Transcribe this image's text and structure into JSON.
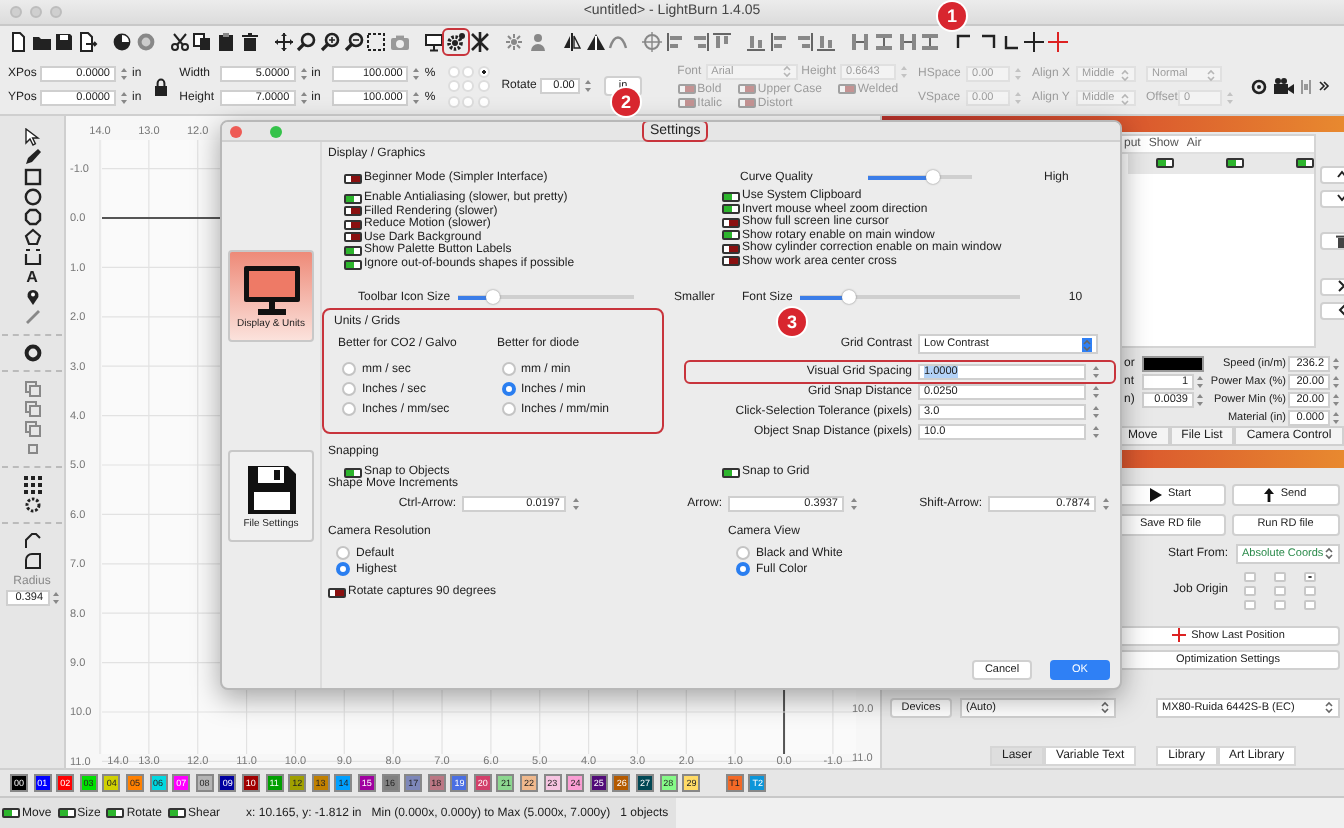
{
  "window": {
    "title": "<untitled> - LightBurn 1.4.05"
  },
  "annotations": [
    {
      "label": "1"
    },
    {
      "label": "2"
    },
    {
      "label": "3"
    }
  ],
  "toolbar": {
    "settings_button": {
      "annotated": true
    }
  },
  "property_bar": {
    "xpos": {
      "label": "XPos",
      "value": "0.0000",
      "unit": "in"
    },
    "ypos": {
      "label": "YPos",
      "value": "0.0000",
      "unit": "in"
    },
    "width": {
      "label": "Width",
      "value": "5.0000",
      "unit": "in"
    },
    "height": {
      "label": "Height",
      "value": "7.0000",
      "unit": "in"
    },
    "scale_x": {
      "value": "100.000",
      "unit": "%"
    },
    "scale_y": {
      "value": "100.000",
      "unit": "%"
    },
    "origin": [
      {
        "selected": false
      },
      {
        "selected": false
      },
      {
        "selected": true
      },
      {
        "selected": false
      },
      {
        "selected": false
      },
      {
        "selected": false
      },
      {
        "selected": false
      },
      {
        "selected": false
      },
      {
        "selected": false
      }
    ],
    "rotate": {
      "label": "Rotate",
      "value": "0.00"
    },
    "unit_button": "in",
    "text_tools_disabled": true,
    "font": {
      "label": "Font",
      "value": "Arial"
    },
    "text_height": {
      "label": "Height",
      "value": "0.6643"
    },
    "text_options": [
      {
        "label": "Bold",
        "on": false
      },
      {
        "label": "Italic",
        "on": false
      },
      {
        "label": "Upper Case",
        "on": false
      },
      {
        "label": "Distort",
        "on": false
      },
      {
        "label": "Welded",
        "on": false
      }
    ],
    "hspace": {
      "label": "HSpace",
      "value": "0.00"
    },
    "vspace": {
      "label": "VSpace",
      "value": "0.00"
    },
    "align_x": {
      "label": "Align X",
      "value": "Middle"
    },
    "align_y": {
      "label": "Align Y",
      "value": "Middle"
    },
    "mode": {
      "value": "Normal"
    },
    "offset": {
      "label": "Offset",
      "value": "0"
    }
  },
  "tools": {
    "text_glyph": "A",
    "radius": {
      "label": "Radius",
      "value": "0.394"
    }
  },
  "canvas": {
    "top_ruler": [
      "14.0",
      "13.0",
      "12.0"
    ],
    "left_ruler": [
      "-1.0",
      "0.0",
      "1.0",
      "2.0",
      "3.0",
      "4.0",
      "5.0",
      "6.0",
      "7.0",
      "8.0",
      "9.0",
      "10.0",
      "11.0"
    ],
    "bottom_ruler": [
      "14.0",
      "13.0",
      "12.0",
      "11.0",
      "10.0",
      "9.0",
      "8.0",
      "7.0",
      "6.0",
      "5.0",
      "4.0",
      "3.0",
      "2.0",
      "1.0",
      "0.0",
      "-1.0"
    ],
    "right_ruler": [
      "10.0",
      "11.0"
    ]
  },
  "cuts": {
    "columns": [
      "put",
      "Show",
      "Air"
    ],
    "layer": {
      "output": true,
      "show": true,
      "air": true
    }
  },
  "layer_settings": {
    "left": [
      {
        "label": "or",
        "kind": "color",
        "color": "#000000"
      },
      {
        "label": "nt",
        "kind": "number",
        "value": "1"
      },
      {
        "label": "n)",
        "kind": "number",
        "value": "0.0039"
      }
    ],
    "right": [
      {
        "label": "Speed (in/m)",
        "value": "236.2"
      },
      {
        "label": "Power Max (%)",
        "value": "20.00"
      },
      {
        "label": "Power Min (%)",
        "value": "20.00"
      },
      {
        "label": "Material (in)",
        "value": "0.000"
      }
    ]
  },
  "panel_tabs": [
    {
      "label": "Move",
      "selected": false
    },
    {
      "label": "File List",
      "selected": false
    },
    {
      "label": "Camera Control",
      "selected": false
    }
  ],
  "laser": {
    "start": "Start",
    "send": "Send",
    "save": "Save RD file",
    "run": "Run RD file",
    "start_from": {
      "label": "Start From:",
      "value": "Absolute Coords"
    },
    "job_origin": {
      "label": "Job Origin",
      "points": [
        {
          "selected": false
        },
        {
          "selected": false
        },
        {
          "selected": true
        },
        {
          "selected": false
        },
        {
          "selected": false
        },
        {
          "selected": false
        },
        {
          "selected": false
        },
        {
          "selected": false
        },
        {
          "selected": false
        }
      ]
    },
    "show_last": "Show Last Position",
    "optimization": "Optimization Settings",
    "devices": "Devices",
    "port": "(Auto)",
    "device": "MX80-Ruida 6442S-B (EC)"
  },
  "bottom_tabs": [
    {
      "label": "Laser",
      "selected": true
    },
    {
      "label": "Variable Text",
      "selected": false
    },
    {
      "label": "Library",
      "selected": false
    },
    {
      "label": "Art Library",
      "selected": false
    }
  ],
  "palette": [
    {
      "label": "00",
      "color": "#000000"
    },
    {
      "label": "01",
      "color": "#0000ff"
    },
    {
      "label": "02",
      "color": "#ff0000"
    },
    {
      "label": "03",
      "color": "#00e000"
    },
    {
      "label": "04",
      "color": "#d0d000"
    },
    {
      "label": "05",
      "color": "#ff8000"
    },
    {
      "label": "06",
      "color": "#00d8e0"
    },
    {
      "label": "07",
      "color": "#ff00ff"
    },
    {
      "label": "08",
      "color": "#b4b4b4"
    },
    {
      "label": "09",
      "color": "#0000a0"
    },
    {
      "label": "10",
      "color": "#a00000"
    },
    {
      "label": "11",
      "color": "#00a000"
    },
    {
      "label": "12",
      "color": "#a0a000"
    },
    {
      "label": "13",
      "color": "#c08000"
    },
    {
      "label": "14",
      "color": "#00a0ff"
    },
    {
      "label": "15",
      "color": "#a000a0"
    },
    {
      "label": "16",
      "color": "#808080"
    },
    {
      "label": "17",
      "color": "#7d87b9"
    },
    {
      "label": "18",
      "color": "#bb7784"
    },
    {
      "label": "19",
      "color": "#4a6fe3"
    },
    {
      "label": "20",
      "color": "#d33f6a"
    },
    {
      "label": "21",
      "color": "#8cd78f"
    },
    {
      "label": "22",
      "color": "#f0b98d"
    },
    {
      "label": "23",
      "color": "#f6c4e1"
    },
    {
      "label": "24",
      "color": "#fa9ed4"
    },
    {
      "label": "25",
      "color": "#500a78"
    },
    {
      "label": "26",
      "color": "#b45a00"
    },
    {
      "label": "27",
      "color": "#004754"
    },
    {
      "label": "28",
      "color": "#86fa88"
    },
    {
      "label": "29",
      "color": "#ffdb66"
    },
    {
      "label": "T1",
      "color": "#f36926"
    },
    {
      "label": "T2",
      "color": "#0c96d9"
    }
  ],
  "status": {
    "toggles": [
      {
        "label": "Move",
        "on": true
      },
      {
        "label": "Size",
        "on": true
      },
      {
        "label": "Rotate",
        "on": true
      },
      {
        "label": "Shear",
        "on": true
      }
    ],
    "position": "x: 10.165, y: -1.812 in",
    "bounds": "Min (0.000x, 0.000y) to Max (5.000x, 7.000y)",
    "count": "1 objects"
  },
  "settings": {
    "title": {
      "text": "Settings",
      "annotated": true
    },
    "pages": [
      {
        "label": "Display & Units",
        "kind": "display",
        "selected": true
      },
      {
        "label": "File Settings",
        "kind": "file",
        "selected": false
      }
    ],
    "display_heading": "Display / Graphics",
    "display_toggles": [
      {
        "label": "Beginner Mode (Simpler Interface)",
        "on": false
      },
      {
        "label": "Enable Antialiasing (slower, but pretty)",
        "on": true
      },
      {
        "label": "Filled Rendering (slower)",
        "on": false
      },
      {
        "label": "Reduce Motion (slower)",
        "on": false
      },
      {
        "label": "Use Dark Background",
        "on": false
      },
      {
        "label": "Show Palette Button Labels",
        "on": true
      },
      {
        "label": "Ignore out-of-bounds shapes if possible",
        "on": true
      }
    ],
    "curve_quality": {
      "label": "Curve Quality",
      "level": 0.62,
      "end_label": "High"
    },
    "misc_toggles": [
      {
        "label": "Use System Clipboard",
        "on": true
      },
      {
        "label": "Invert mouse wheel zoom direction",
        "on": true
      },
      {
        "label": "Show full screen line cursor",
        "on": false
      },
      {
        "label": "Show rotary enable on main window",
        "on": true
      },
      {
        "label": "Show cylinder correction enable on main window",
        "on": false
      },
      {
        "label": "Show work area center cross",
        "on": false
      }
    ],
    "toolbar_icon_size": {
      "label": "Toolbar Icon Size",
      "level": 0.2,
      "end_label": "Smaller"
    },
    "font_size": {
      "label": "Font Size",
      "level": 0.22,
      "value": "10"
    },
    "units": {
      "heading": "Units / Grids",
      "annotated": true,
      "groups": [
        {
          "heading": "Better for CO2 / Galvo",
          "options": [
            {
              "label": "mm / sec",
              "selected": false
            },
            {
              "label": "Inches / sec",
              "selected": false
            },
            {
              "label": "Inches / mm/sec",
              "selected": false
            }
          ]
        },
        {
          "heading": "Better for diode",
          "options": [
            {
              "label": "mm / min",
              "selected": false
            },
            {
              "label": "Inches / min",
              "selected": true
            },
            {
              "label": "Inches / mm/min",
              "selected": false
            }
          ]
        }
      ]
    },
    "grid_contrast": {
      "label": "Grid Contrast",
      "value": "Low Contrast"
    },
    "grid_fields": [
      {
        "label": "Visual Grid Spacing",
        "value": "1.0000",
        "annotated": true
      },
      {
        "label": "Grid Snap Distance",
        "value": "0.0250",
        "annotated": false
      },
      {
        "label": "Click-Selection Tolerance (pixels)",
        "value": "3.0",
        "annotated": false
      },
      {
        "label": "Object Snap Distance (pixels)",
        "value": "10.0",
        "annotated": false
      }
    ],
    "snapping": {
      "heading": "Snapping",
      "toggles": [
        {
          "label": "Snap to Objects",
          "on": true
        },
        {
          "label": "Snap to Grid",
          "on": true
        }
      ]
    },
    "move_increments": {
      "heading": "Shape Move Increments",
      "fields": [
        {
          "label": "Ctrl-Arrow:",
          "value": "0.0197"
        },
        {
          "label": "Arrow:",
          "value": "0.3937"
        },
        {
          "label": "Shift-Arrow:",
          "value": "0.7874"
        }
      ]
    },
    "camera_resolution": {
      "heading": "Camera Resolution",
      "options": [
        {
          "label": "Default",
          "selected": false
        },
        {
          "label": "Highest",
          "selected": true
        }
      ]
    },
    "camera_view": {
      "heading": "Camera View",
      "options": [
        {
          "label": "Black and White",
          "selected": false
        },
        {
          "label": "Full Color",
          "selected": true
        }
      ]
    },
    "rotate_captures": {
      "label": "Rotate captures 90 degrees",
      "on": false
    },
    "buttons": [
      {
        "label": "Cancel",
        "kind": "cancel"
      },
      {
        "label": "OK",
        "kind": "default"
      }
    ]
  }
}
